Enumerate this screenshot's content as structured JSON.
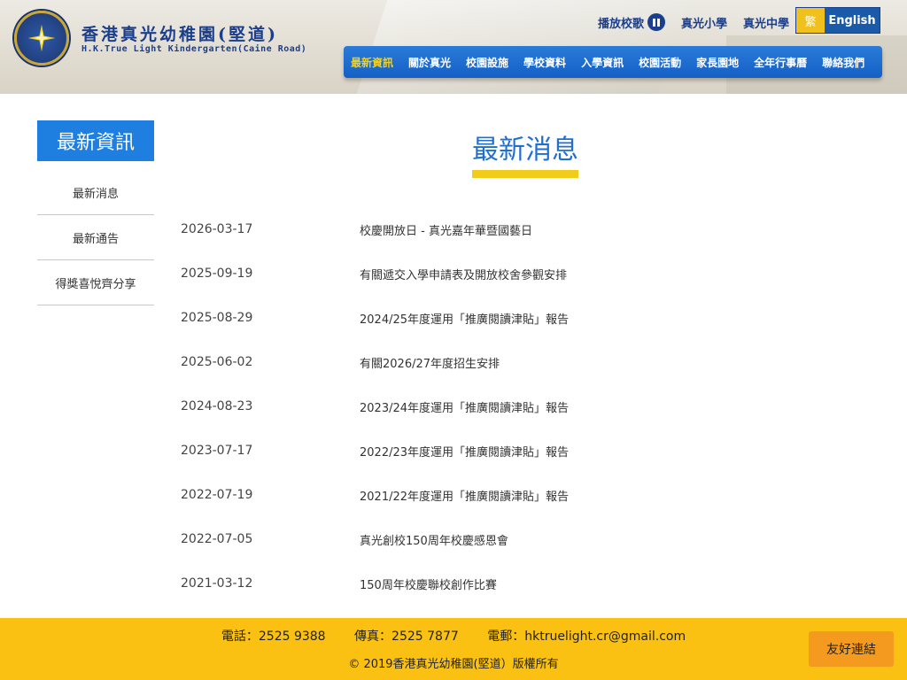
{
  "header": {
    "school_name_zh": "香港真光幼稚園(堅道)",
    "school_name_en": "H.K.True Light Kindergarten(Caine Road)",
    "top_links": {
      "school_song": "播放校歌",
      "primary": "真光小學",
      "secondary": "真光中學"
    },
    "lang": {
      "traditional": "繁",
      "english": "English"
    },
    "nav": [
      "最新資訊",
      "關於真光",
      "校園設施",
      "學校資料",
      "入學資訊",
      "校園活動",
      "家長園地",
      "全年行事曆",
      "聯絡我們"
    ],
    "nav_active": "最新資訊"
  },
  "sidebar": {
    "title": "最新資訊",
    "items": [
      "最新消息",
      "最新通告",
      "得獎喜悅齊分享"
    ]
  },
  "main": {
    "title": "最新消息",
    "news": [
      {
        "date": "2026-03-17",
        "title": "校慶開放日 - 真光嘉年華暨國藝日"
      },
      {
        "date": "2025-09-19",
        "title": "有關遞交入學申請表及開放校舍參觀安排"
      },
      {
        "date": "2025-08-29",
        "title": "2024/25年度運用「推廣閱讀津貼」報告"
      },
      {
        "date": "2025-06-02",
        "title": "有關2026/27年度招生安排"
      },
      {
        "date": "2024-08-23",
        "title": "2023/24年度運用「推廣閱讀津貼」報告"
      },
      {
        "date": "2023-07-17",
        "title": "2022/23年度運用「推廣閱讀津貼」報告"
      },
      {
        "date": "2022-07-19",
        "title": "2021/22年度運用「推廣閱讀津貼」報告"
      },
      {
        "date": "2022-07-05",
        "title": "真光創校150周年校慶感恩會"
      },
      {
        "date": "2021-03-12",
        "title": "150周年校慶聯校創作比賽"
      }
    ]
  },
  "footer": {
    "phone": "電話：2525 9388",
    "fax": "傳真：2525 7877",
    "email": "電郵：hktruelight.cr@gmail.com",
    "copyright": "© 2019香港真光幼稚園(堅道）版權所有",
    "friends_button": "友好連結"
  },
  "colors": {
    "brand_blue": "#1f7fe0",
    "nav_blue": "#1460c6",
    "accent_yellow": "#f2cc1a",
    "footer_yellow": "#fbc112",
    "button_orange": "#f39a1f"
  },
  "icons": {
    "logo": "school-crest-icon",
    "song_toggle": "pause-icon"
  }
}
